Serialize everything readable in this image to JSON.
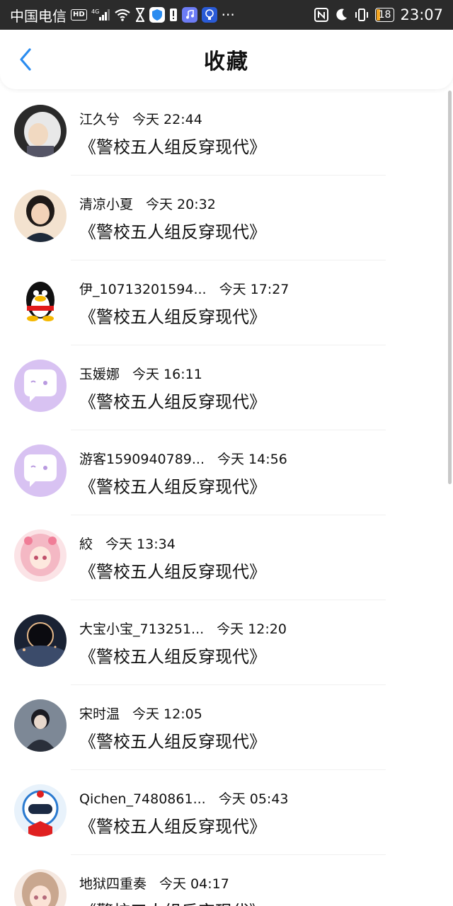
{
  "status_bar": {
    "carrier": "中国电信",
    "hd": "HD",
    "network": "4G",
    "battery": "18",
    "time": "23:07",
    "more": "···"
  },
  "header": {
    "title": "收藏",
    "back_icon": "chevron-left-icon",
    "accent": "#2a8cf0"
  },
  "items": [
    {
      "user": "江久兮",
      "time": "今天 22:44",
      "book": "《警校五人组反穿现代》"
    },
    {
      "user": "清凉小夏",
      "time": "今天 20:32",
      "book": "《警校五人组反穿现代》"
    },
    {
      "user": "伊_10713201594...",
      "time": "今天 17:27",
      "book": "《警校五人组反穿现代》"
    },
    {
      "user": "玉媛娜",
      "time": "今天 16:11",
      "book": "《警校五人组反穿现代》"
    },
    {
      "user": "游客1590940789...",
      "time": "今天 14:56",
      "book": "《警校五人组反穿现代》"
    },
    {
      "user": "絞",
      "time": "今天 13:34",
      "book": "《警校五人组反穿现代》"
    },
    {
      "user": "大宝小宝_713251...",
      "time": "今天 12:20",
      "book": "《警校五人组反穿现代》"
    },
    {
      "user": "宋时温",
      "time": "今天 12:05",
      "book": "《警校五人组反穿现代》"
    },
    {
      "user": "Qichen_7480861...",
      "time": "今天 05:43",
      "book": "《警校五人组反穿现代》"
    },
    {
      "user": "地狱四重奏",
      "time": "今天 04:17",
      "book": "《警校五人组反穿现代》"
    }
  ]
}
